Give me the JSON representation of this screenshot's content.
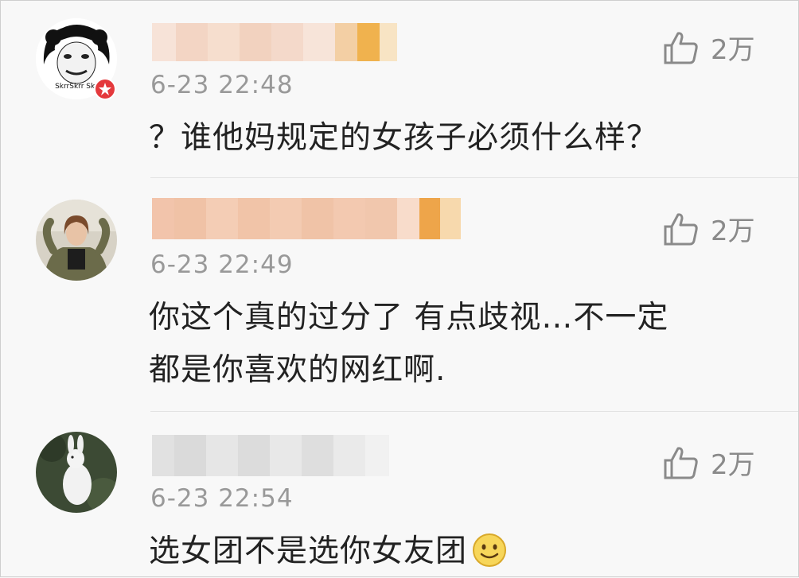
{
  "comments": [
    {
      "timestamp": "6-23 22:48",
      "likes": "2万",
      "text": "？谁他妈规定的女孩子必须什么样？",
      "avatar_icon": "meme-avatar",
      "avatar_caption": "SkrrSkrr Skr",
      "has_verified_badge": true
    },
    {
      "timestamp": "6-23 22:49",
      "likes": "2万",
      "text_line1": "你这个真的过分了 有点歧视…不一定",
      "text_line2": "都是你喜欢的网红啊.",
      "avatar_icon": "photo-avatar-girl"
    },
    {
      "timestamp": "6-23 22:54",
      "likes": "2万",
      "text": "选女团不是选你女友团",
      "emoji": "smile-emoji",
      "avatar_icon": "photo-avatar-rabbit"
    }
  ],
  "colors": {
    "background": "#f8f8f8",
    "timestamp": "#999999",
    "text": "#222222",
    "like": "#8a8a8a",
    "divider": "#e3e3e3",
    "badge": "#e4393c"
  }
}
